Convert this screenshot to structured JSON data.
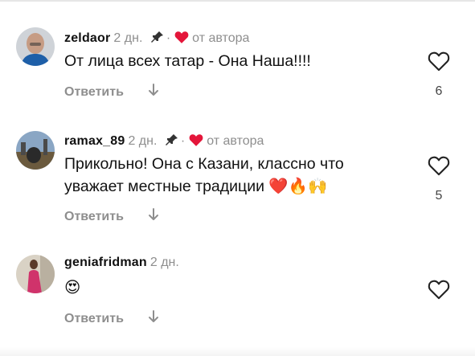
{
  "comments": [
    {
      "username": "zeldaor",
      "time": "2 дн.",
      "separator": "·",
      "author_note": "от автора",
      "text": "От лица всех татар - Она Наша!!!!",
      "reply_label": "Ответить",
      "like_count": "6"
    },
    {
      "username": "ramax_89",
      "time": "2 дн.",
      "separator": "·",
      "author_note": "от автора",
      "text_line1": "Прикольно!  Она с Казани, классно что",
      "text_line2": "уважает местные традиции",
      "emojis": "❤️🔥🙌",
      "reply_label": "Ответить",
      "like_count": "5"
    },
    {
      "username": "geniafridman",
      "time": "2 дн.",
      "emoji_text": "😍",
      "reply_label": "Ответить"
    }
  ],
  "colors": {
    "author_heart": "#e4163a",
    "muted": "#8e8e8e",
    "text": "#111111"
  },
  "icons": {
    "pin": "pin-icon",
    "like": "heart-outline-icon",
    "expand": "arrow-down-icon"
  }
}
